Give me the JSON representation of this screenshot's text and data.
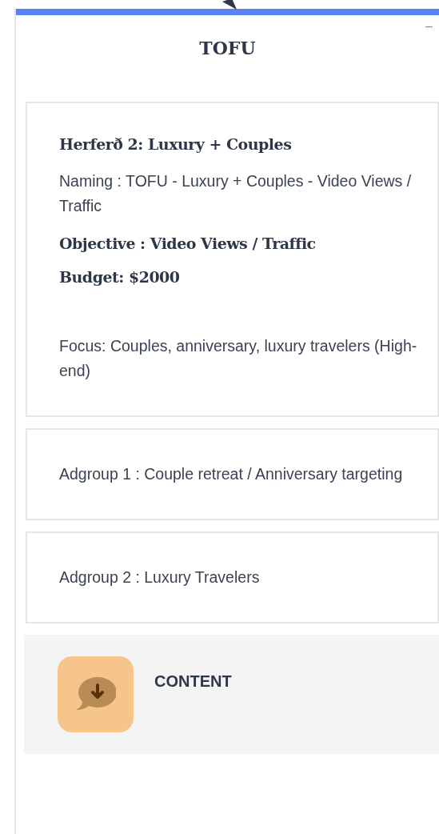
{
  "panel": {
    "title": "TOFU",
    "minimize": "–"
  },
  "cards": [
    {
      "items": [
        {
          "kind": "heading",
          "text": "Herferð 2: Luxury + Couples"
        },
        {
          "kind": "text",
          "text": "Naming : TOFU - Luxury + Couples  - Video Views / Traffic"
        },
        {
          "kind": "heading",
          "text": "Objective :  Video Views / Traffic"
        },
        {
          "kind": "heading",
          "text": "Budget: $2000"
        },
        {
          "kind": "note",
          "text": "Focus: Couples, anniversary, luxury travelers (High-end)"
        }
      ]
    },
    {
      "items": [
        {
          "kind": "text",
          "text": "Adgroup 1 : Couple retreat / Anniversary targeting"
        }
      ]
    },
    {
      "items": [
        {
          "kind": "text",
          "text": "Adgroup 2 : Luxury Travelers"
        }
      ]
    }
  ],
  "footer": {
    "label": "CONTENT"
  }
}
